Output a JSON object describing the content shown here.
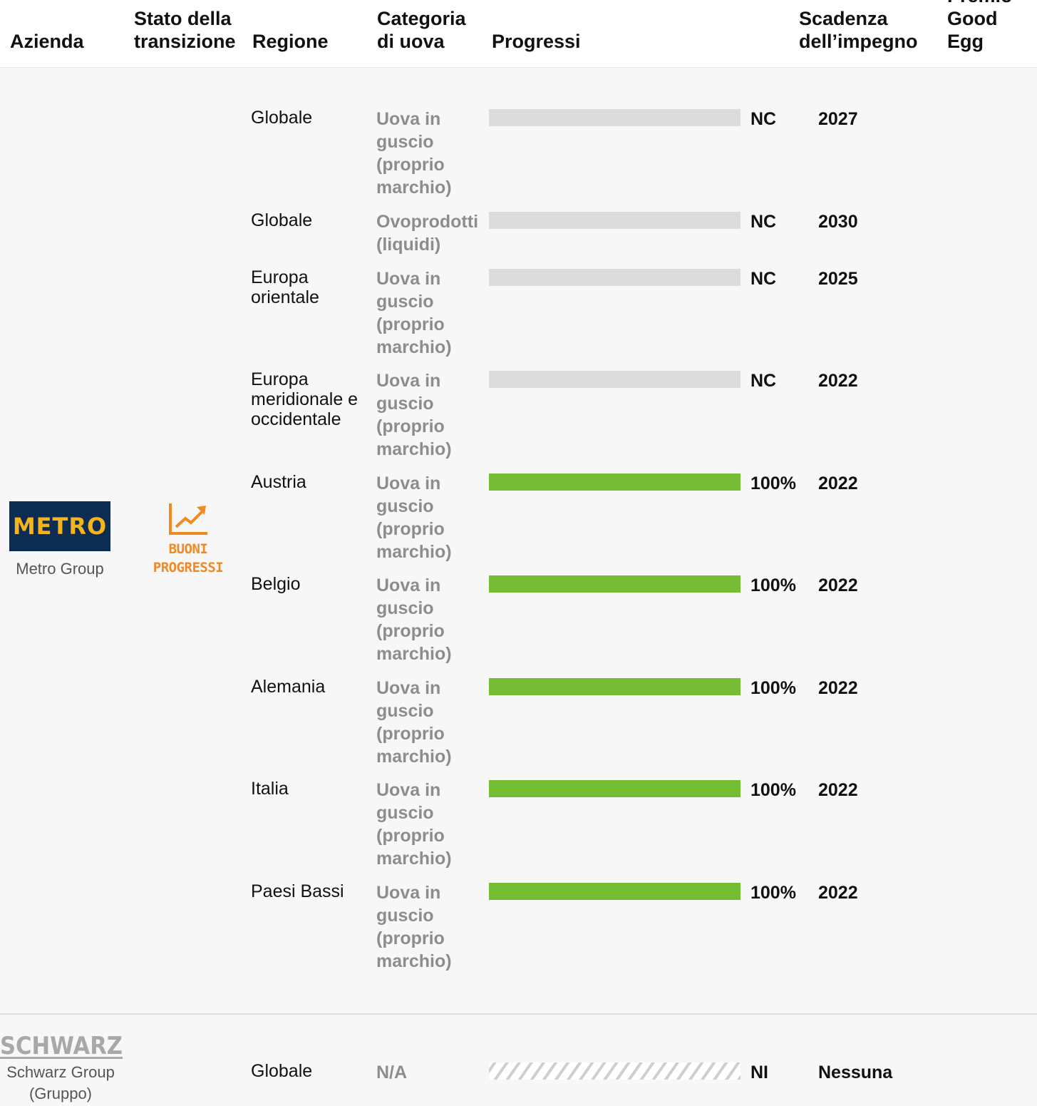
{
  "header": {
    "company": "Azienda",
    "status": "Stato della\ntransizione",
    "region": "Regione",
    "category": "Categoria\ndi uova",
    "progress": "Progressi",
    "deadline": "Scadenza\ndell’impegno",
    "award": "Premio\nGood Egg"
  },
  "colors": {
    "progress_fill": "#76bc35",
    "progress_track": "#dcdcdc",
    "status_accent": "#f08a24",
    "metro_logo_bg": "#0d2c52",
    "metro_logo_text": "#f6b41c"
  },
  "companies": [
    {
      "logo_text": "METRO",
      "name": "Metro Group",
      "status_icon": "trend-up-icon",
      "status_label": "BUONI\nPROGRESSI",
      "rows": [
        {
          "region": "Globale",
          "category": "Uova in guscio (proprio marchio)",
          "progress_value": 0,
          "progress_label": "NC",
          "deadline": "2027"
        },
        {
          "region": "Globale",
          "category": "Ovoprodotti (liquidi)",
          "progress_value": 0,
          "progress_label": "NC",
          "deadline": "2030"
        },
        {
          "region": "Europa orientale",
          "category": "Uova in guscio (proprio marchio)",
          "progress_value": 0,
          "progress_label": "NC",
          "deadline": "2025"
        },
        {
          "region": "Europa meridionale e occidentale",
          "category": "Uova in guscio (proprio marchio)",
          "progress_value": 0,
          "progress_label": "NC",
          "deadline": "2022"
        },
        {
          "region": "Austria",
          "category": "Uova in guscio (proprio marchio)",
          "progress_value": 100,
          "progress_label": "100%",
          "deadline": "2022"
        },
        {
          "region": "Belgio",
          "category": "Uova in guscio (proprio marchio)",
          "progress_value": 100,
          "progress_label": "100%",
          "deadline": "2022"
        },
        {
          "region": "Alemania",
          "category": "Uova in guscio (proprio marchio)",
          "progress_value": 100,
          "progress_label": "100%",
          "deadline": "2022"
        },
        {
          "region": "Italia",
          "category": "Uova in guscio (proprio marchio)",
          "progress_value": 100,
          "progress_label": "100%",
          "deadline": "2022"
        },
        {
          "region": "Paesi Bassi",
          "category": "Uova in guscio (proprio marchio)",
          "progress_value": 100,
          "progress_label": "100%",
          "deadline": "2022"
        }
      ]
    },
    {
      "logo_text": "SCHWARZ",
      "name": "Schwarz Group\n(Gruppo)",
      "rows": [
        {
          "region": "Globale",
          "category": "N/A",
          "progress_value": null,
          "progress_label": "NI",
          "deadline": "Nessuna"
        }
      ]
    }
  ]
}
